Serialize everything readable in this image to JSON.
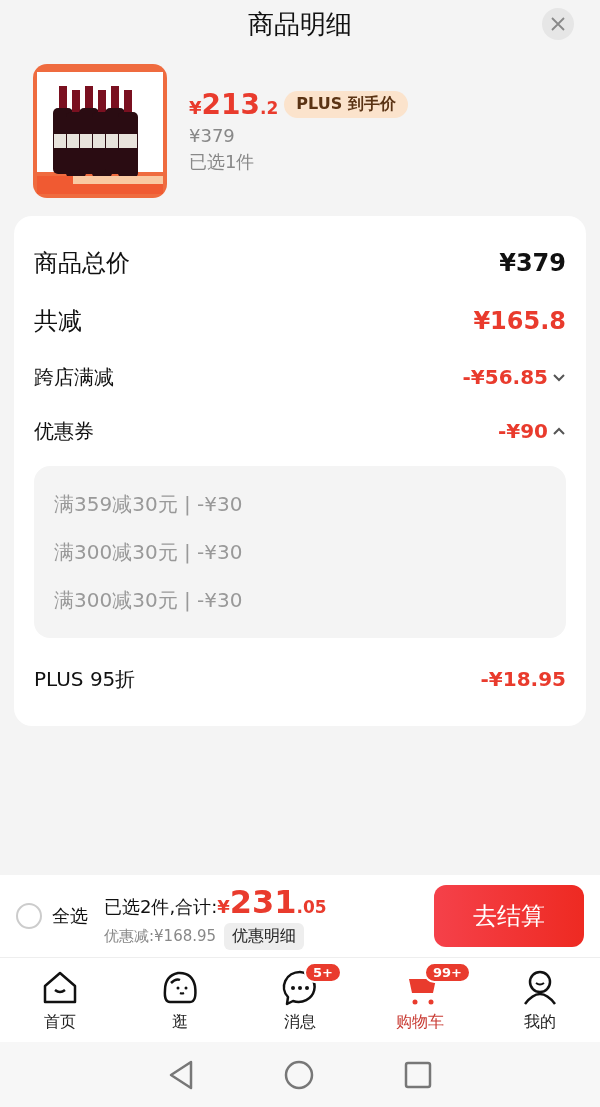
{
  "header": {
    "title": "商品明细"
  },
  "product": {
    "price_symbol": "¥",
    "price_integer": "213",
    "price_decimal": ".2",
    "price_tag": "PLUS 到手价",
    "original_price": "¥379",
    "selected_count": "已选1件"
  },
  "summary": {
    "rows": [
      {
        "kind": "major",
        "label": "商品总价",
        "value": "¥379",
        "highlight": false
      },
      {
        "kind": "major",
        "label": "共减",
        "value": "¥165.8",
        "highlight": true
      },
      {
        "kind": "expandable",
        "label": "跨店满减",
        "value": "-¥56.85",
        "expanded": false
      },
      {
        "kind": "expandable",
        "label": "优惠券",
        "value": "-¥90",
        "expanded": true,
        "children": [
          "满359减30元 | -¥30",
          "满300减30元 | -¥30",
          "满300减30元 | -¥30"
        ]
      },
      {
        "kind": "plain",
        "label": "PLUS 95折",
        "value": "-¥18.95"
      }
    ]
  },
  "checkout_bar": {
    "select_all": {
      "label": "全选",
      "checked": false
    },
    "selected_text": "已选2件,合计:",
    "total_symbol": "¥",
    "total_integer": "231",
    "total_decimal": ".05",
    "savings": "优惠减:¥168.95",
    "details_button": "优惠明细",
    "checkout_button": "去结算"
  },
  "tabs": [
    {
      "label": "首页",
      "selected": false
    },
    {
      "label": "逛",
      "selected": false
    },
    {
      "label": "消息",
      "selected": false,
      "badge": "5+"
    },
    {
      "label": "购物车",
      "selected": true,
      "badge": "99+"
    },
    {
      "label": "我的",
      "selected": false
    }
  ]
}
